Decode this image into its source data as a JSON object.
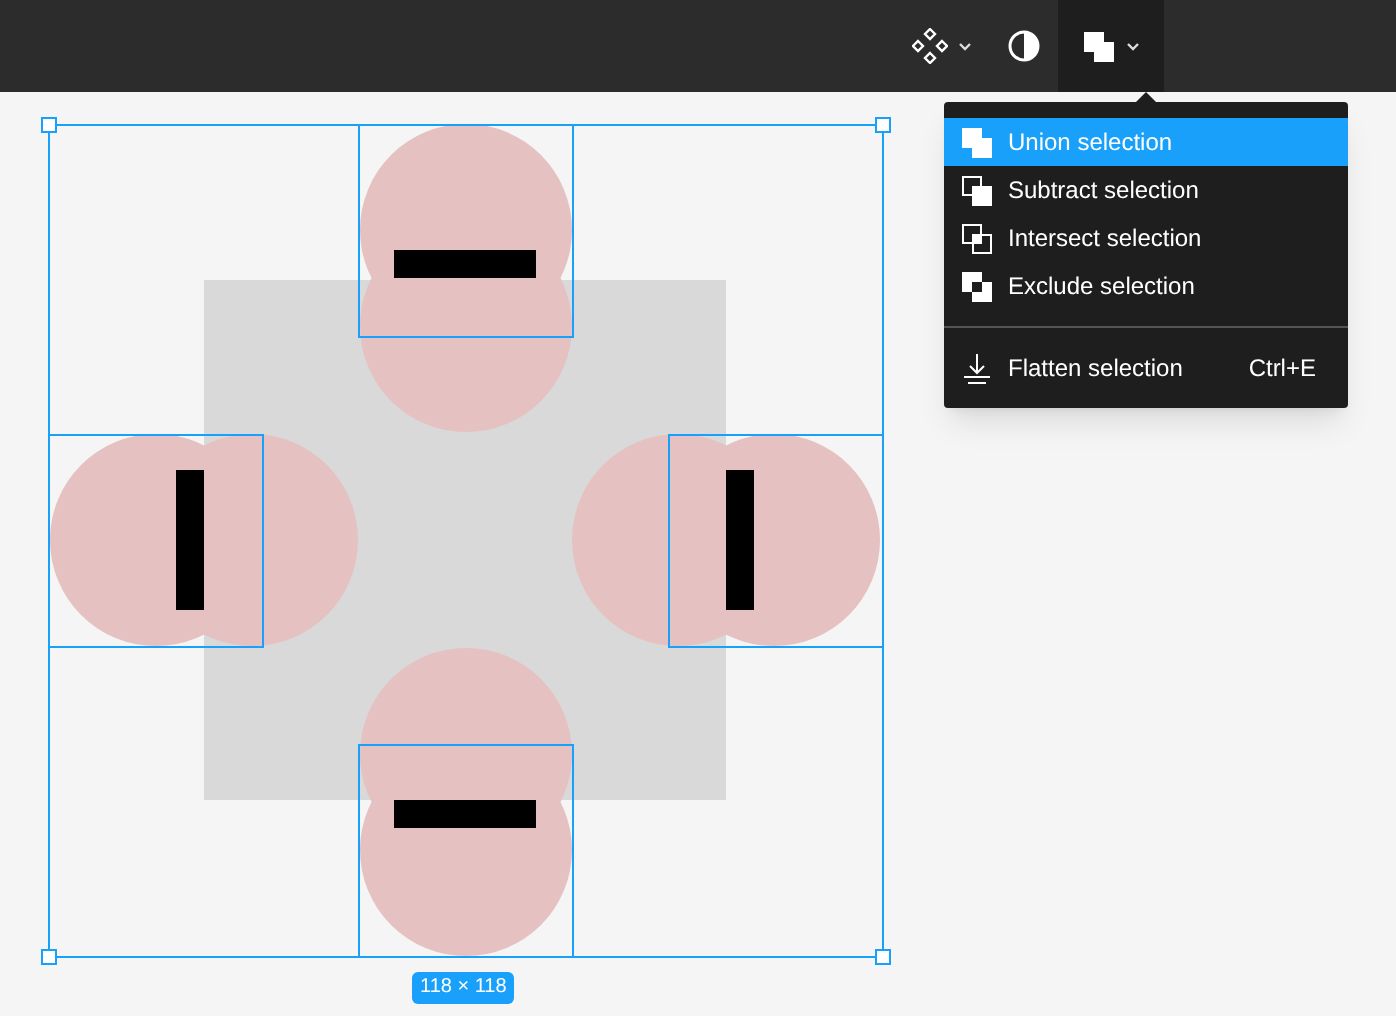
{
  "toolbar": {
    "items": [
      {
        "kind": "components",
        "dropdown": true,
        "selected": false
      },
      {
        "kind": "mask",
        "dropdown": false,
        "selected": false
      },
      {
        "kind": "boolean",
        "dropdown": true,
        "selected": true
      }
    ]
  },
  "menu": {
    "items": [
      {
        "kind": "union",
        "label": "Union selection",
        "selected": true
      },
      {
        "kind": "subtract",
        "label": "Subtract selection",
        "selected": false
      },
      {
        "kind": "intersect",
        "label": "Intersect selection",
        "selected": false
      },
      {
        "kind": "exclude",
        "label": "Exclude selection",
        "selected": false
      }
    ],
    "footer": [
      {
        "kind": "flatten",
        "label": "Flatten selection",
        "shortcut": "Ctrl+E"
      }
    ]
  },
  "canvas": {
    "size_label": "118 × 118"
  }
}
